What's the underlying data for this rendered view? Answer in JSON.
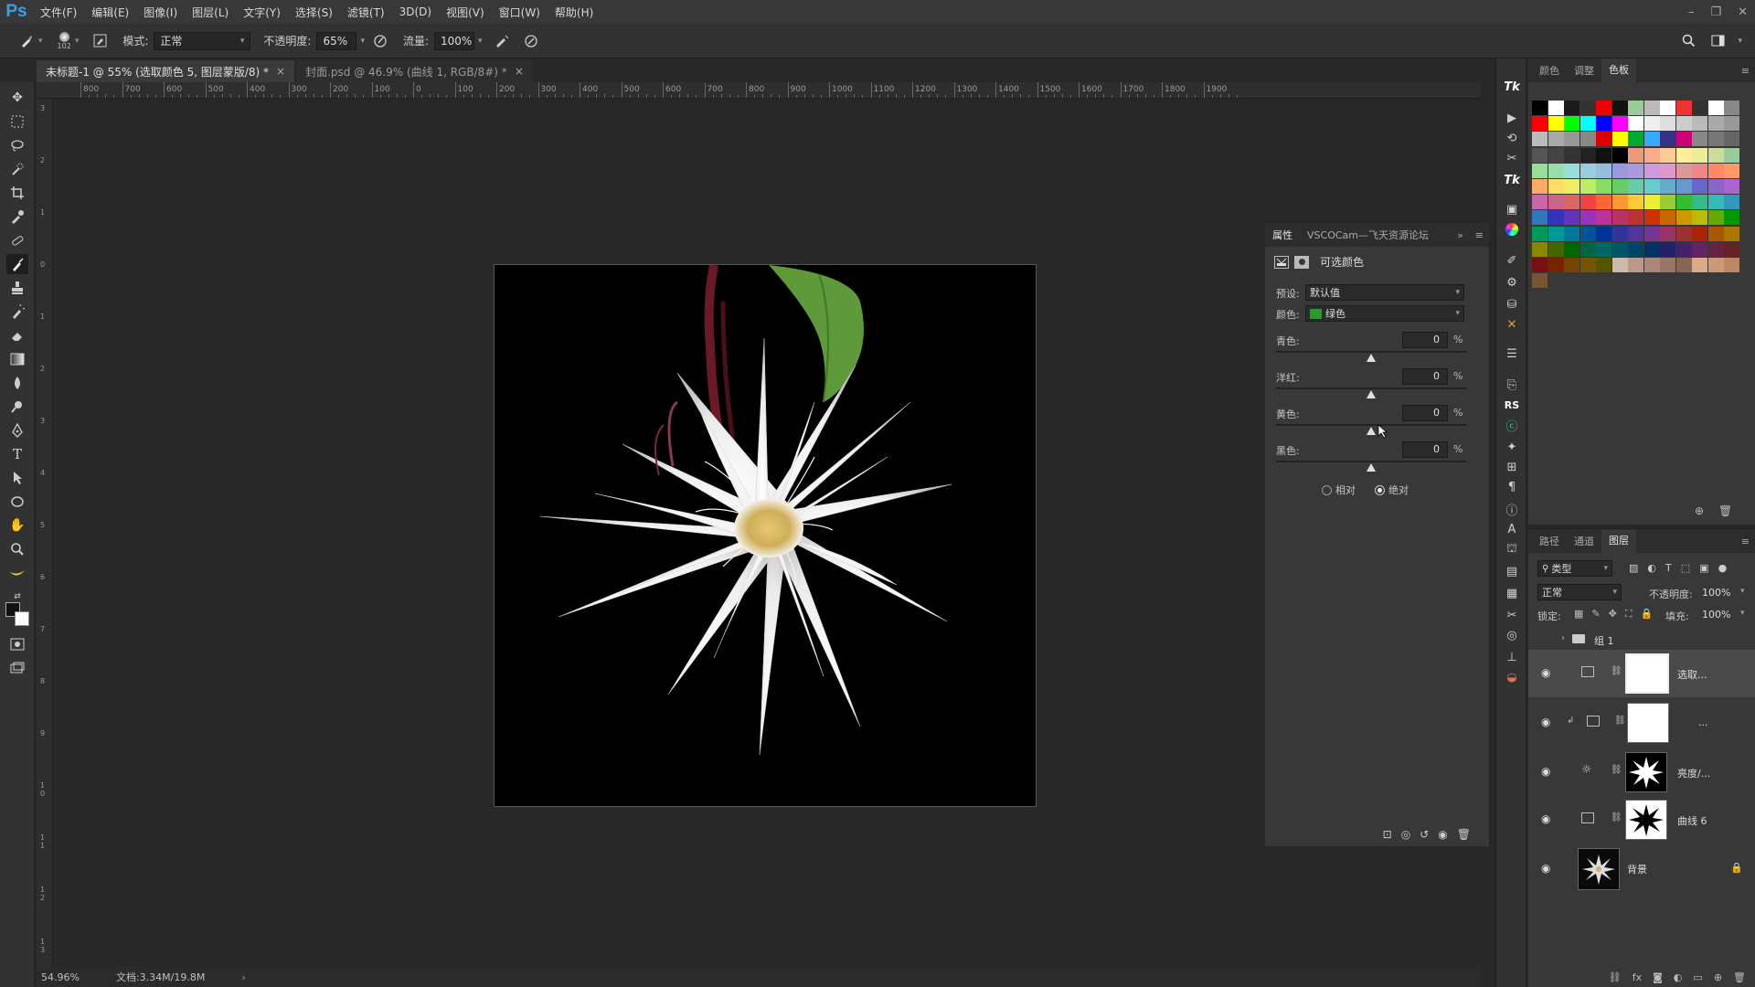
{
  "app": {
    "logo": "Ps",
    "menus": [
      "文件(F)",
      "编辑(E)",
      "图像(I)",
      "图层(L)",
      "文字(Y)",
      "选择(S)",
      "滤镜(T)",
      "3D(D)",
      "视图(V)",
      "窗口(W)",
      "帮助(H)"
    ]
  },
  "options": {
    "brush_size": "102",
    "mode_label": "模式:",
    "mode_value": "正常",
    "opacity_label": "不透明度:",
    "opacity_value": "65%",
    "flow_label": "流量:",
    "flow_value": "100%"
  },
  "tabs": [
    {
      "label": "未标题-1 @ 55% (选取颜色 5, 图层蒙版/8) *",
      "close": "×"
    },
    {
      "label": "封面.psd @ 46.9% (曲线 1, RGB/8#) *",
      "close": "×"
    }
  ],
  "ruler": {
    "h_labels": [
      "800",
      "700",
      "600",
      "500",
      "400",
      "300",
      "200",
      "100",
      "0",
      "100",
      "200",
      "300",
      "400",
      "500",
      "600",
      "700",
      "800",
      "900",
      "1000",
      "1100",
      "1200",
      "1300",
      "1400",
      "1500",
      "1600",
      "1700",
      "1800",
      "1900"
    ],
    "v_labels": [
      "3",
      "2",
      "1",
      "0",
      "1",
      "2",
      "3",
      "4",
      "5",
      "6",
      "7",
      "8",
      "9",
      "10",
      "11",
      "12",
      "13"
    ]
  },
  "status": {
    "zoom": "54.96%",
    "doc": "文档:3.34M/19.8M",
    "arrow": "›"
  },
  "properties": {
    "tabs": [
      "属性",
      "VSCOCam—飞天资源论坛"
    ],
    "title": "可选颜色",
    "preset_label": "预设:",
    "preset_value": "默认值",
    "color_label": "颜色:",
    "color_value": "绿色",
    "color_swatch": "#2a9a2a",
    "sliders": [
      {
        "label": "青色:",
        "value": "0",
        "unit": "%"
      },
      {
        "label": "洋红:",
        "value": "0",
        "unit": "%"
      },
      {
        "label": "黄色:",
        "value": "0",
        "unit": "%"
      },
      {
        "label": "黑色:",
        "value": "0",
        "unit": "%"
      }
    ],
    "radio_relative": "相对",
    "radio_absolute": "绝对"
  },
  "swatches": {
    "tabs": [
      "颜色",
      "调整",
      "色板"
    ]
  },
  "layers": {
    "tabs": [
      "路径",
      "通道",
      "图层"
    ],
    "filter_label": "类型",
    "blend_value": "正常",
    "opacity_label": "不透明度:",
    "opacity_value": "100%",
    "lock_label": "锁定:",
    "fill_label": "填充:",
    "fill_value": "100%",
    "group_name": "组 1",
    "items": [
      {
        "name": "选取..."
      },
      {
        "name": "..."
      },
      {
        "name": "亮度/..."
      },
      {
        "name": "曲线 6"
      },
      {
        "name": "背景"
      }
    ]
  }
}
